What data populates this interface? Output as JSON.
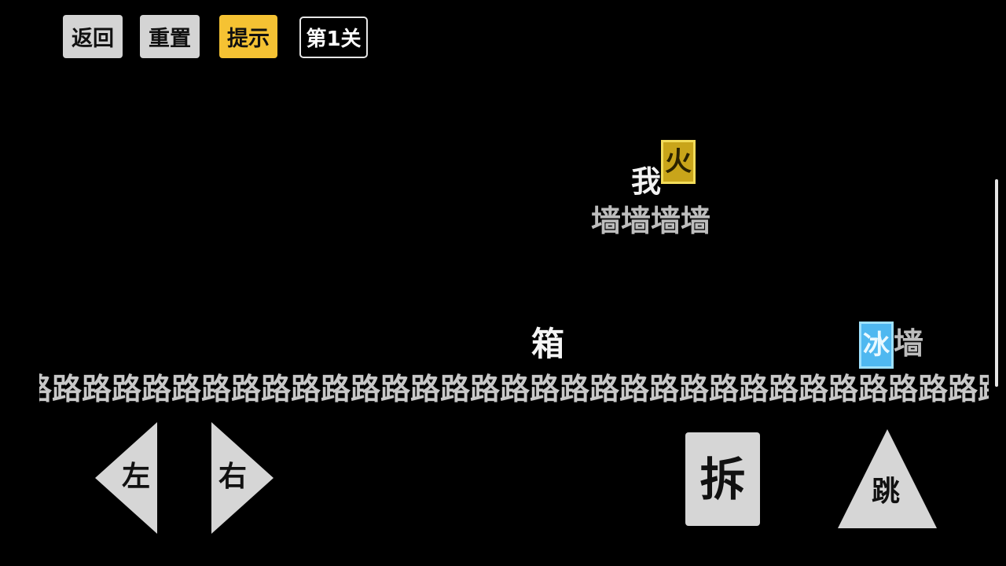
{
  "toolbar": {
    "back_label": "返回",
    "reset_label": "重置",
    "hint_label": "提示",
    "level_label": "第1关"
  },
  "scene": {
    "player": "我",
    "fire_block": "火",
    "wall_platform": "墙墙墙墙",
    "box": "箱",
    "ice_block": "冰",
    "wall_small": "墙",
    "road": "路路路路路路路路路路路路路路路路路路路路路路路路路路路路路路路路路"
  },
  "controls": {
    "left_label": "左",
    "right_label": "右",
    "demolish_label": "拆",
    "jump_label": "跳"
  },
  "colors": {
    "background": "#000000",
    "hint_button": "#f5c233",
    "fire_block": "#c9a51a",
    "ice_block": "#4fb8f0",
    "control_fill": "#d6d6d6"
  }
}
